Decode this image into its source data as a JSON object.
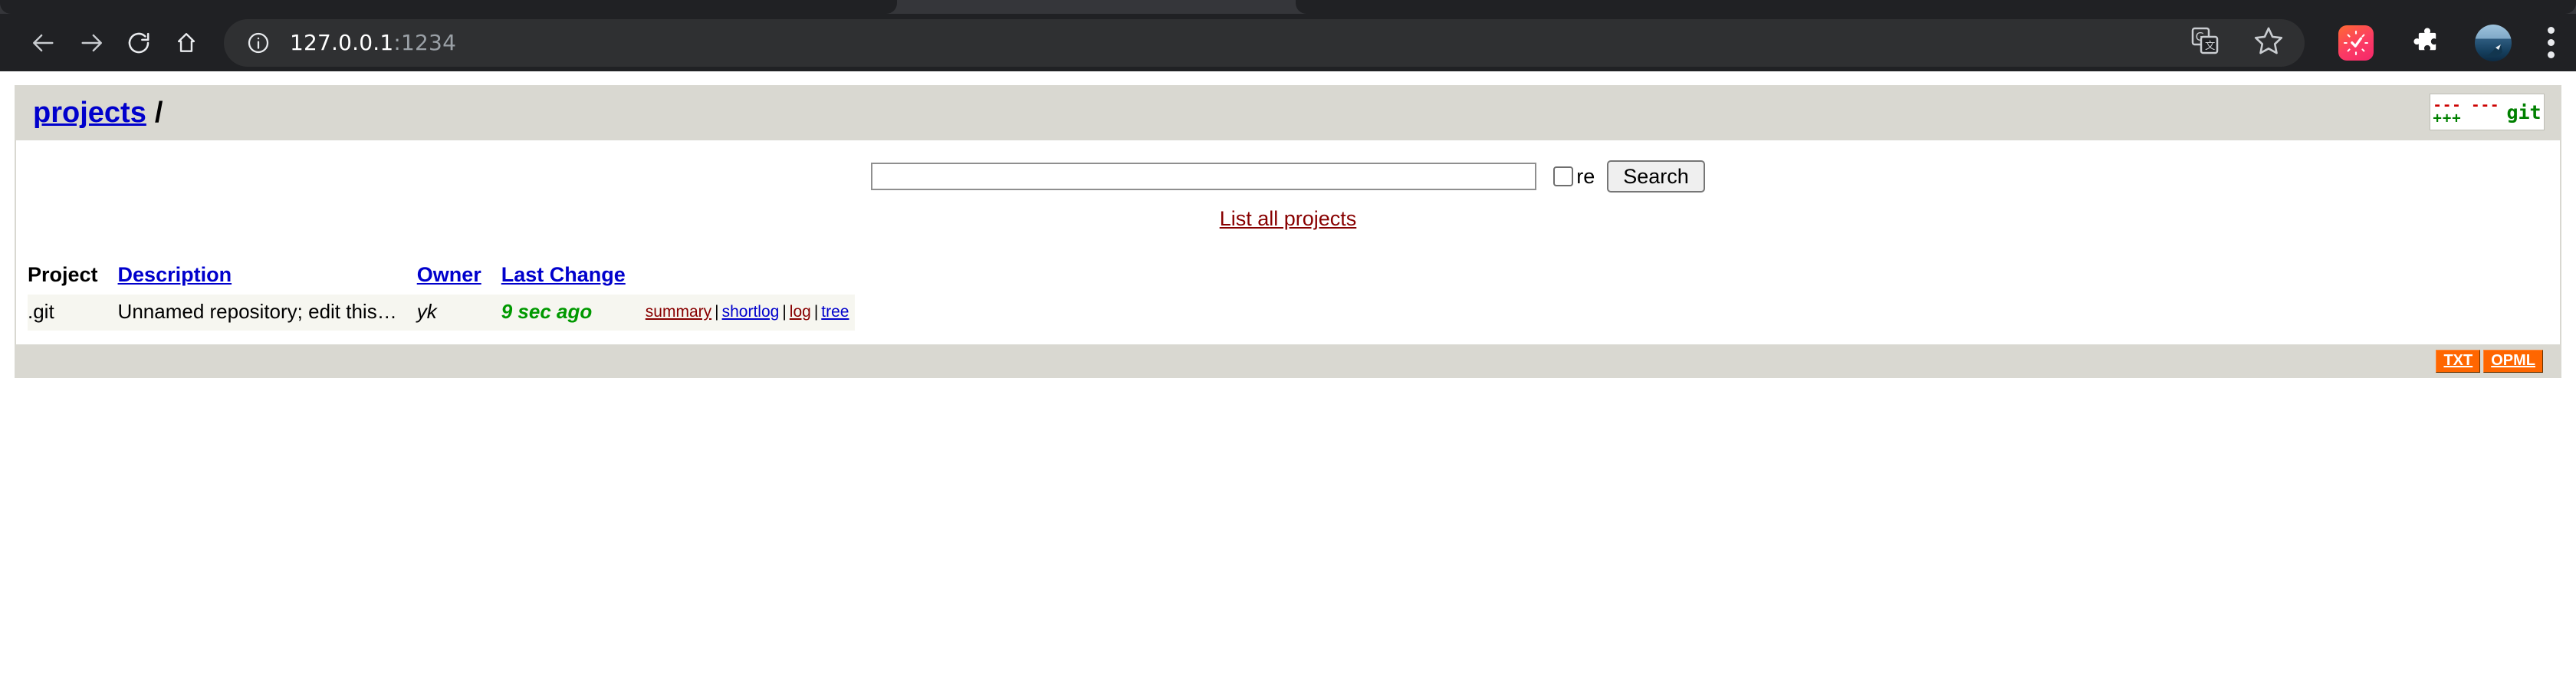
{
  "browser": {
    "back_icon": "back-arrow-icon",
    "forward_icon": "forward-arrow-icon",
    "reload_icon": "reload-icon",
    "home_icon": "home-icon",
    "site_info_icon": "info-circle-icon",
    "url_host": "127.0.0.1",
    "url_port": ":1234",
    "translate_icon": "translate-icon",
    "bookmark_icon": "star-icon",
    "extension_clock_icon": "clock-extension-icon",
    "extensions_icon": "puzzle-piece-icon",
    "profile_icon": "avatar-icon",
    "menu_icon": "three-dot-menu-icon"
  },
  "header": {
    "project_root_link": "projects",
    "separator": "/",
    "logo_minus": "--- ---",
    "logo_plus": "+++",
    "logo_word": "git"
  },
  "search": {
    "value": "",
    "placeholder": "",
    "regexp_label": "re",
    "regexp_checked": false,
    "button_label": "Search",
    "list_all_label": "List all projects"
  },
  "table": {
    "columns": [
      {
        "label": "Project",
        "is_link": false
      },
      {
        "label": "Description",
        "is_link": true
      },
      {
        "label": "Owner",
        "is_link": true
      },
      {
        "label": "Last Change",
        "is_link": true
      }
    ],
    "rows": [
      {
        "project": ".git",
        "description": "Unnamed repository; edit this…",
        "owner": "yk",
        "last_change": "9 sec ago",
        "actions": [
          {
            "label": "summary",
            "state": "visited"
          },
          {
            "label": "shortlog",
            "state": "unvisited"
          },
          {
            "label": "log",
            "state": "visited"
          },
          {
            "label": "tree",
            "state": "unvisited"
          }
        ],
        "action_separator": "|"
      }
    ]
  },
  "footer": {
    "feeds": [
      {
        "label": "TXT"
      },
      {
        "label": "OPML"
      }
    ]
  },
  "colors": {
    "chrome_toolbar": "#202124",
    "chrome_tabstrip": "#35363a",
    "gitweb_bar": "#d9d8d1",
    "row_background": "#f6f6f0",
    "link_unvisited": "#0000cc",
    "link_visited": "#880000",
    "age_green": "#009900",
    "feed_orange": "#ff6600"
  }
}
